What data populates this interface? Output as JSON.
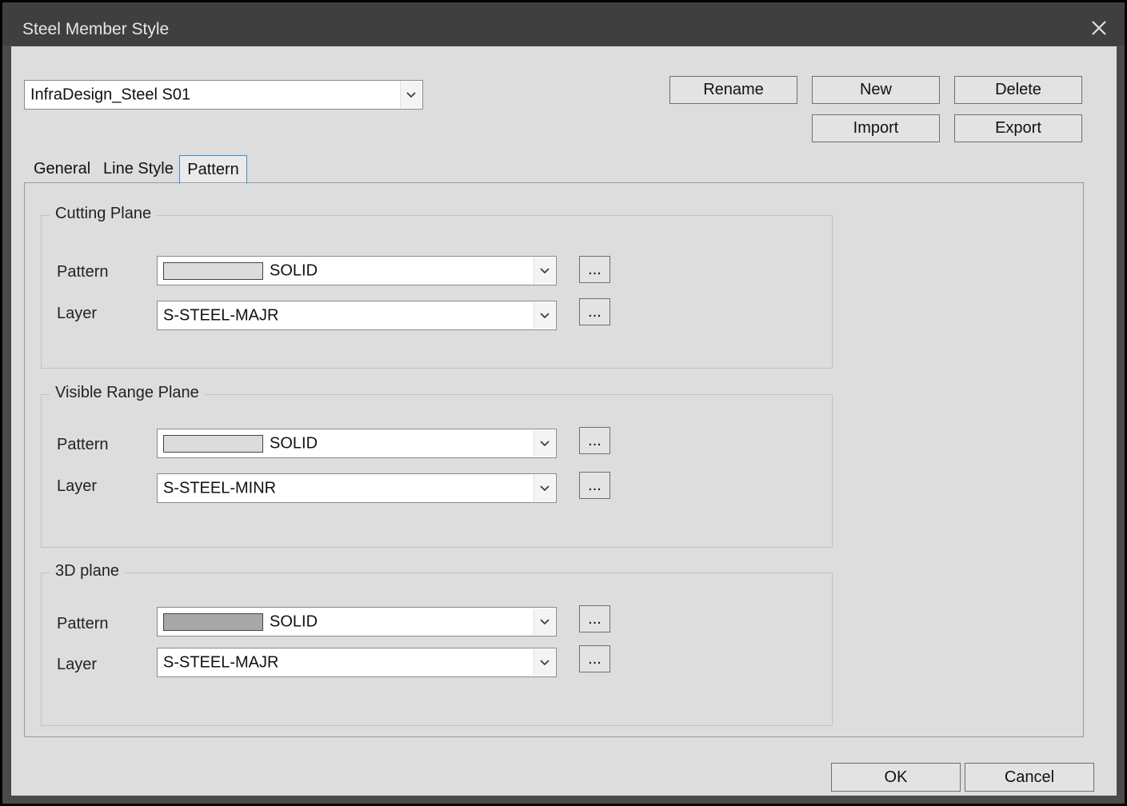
{
  "window": {
    "title": "Steel Member Style"
  },
  "style_selector": {
    "value": "InfraDesign_Steel S01"
  },
  "buttons": {
    "rename": "Rename",
    "new": "New",
    "delete": "Delete",
    "import": "Import",
    "export": "Export",
    "ok": "OK",
    "cancel": "Cancel"
  },
  "tabs": [
    {
      "label": "General",
      "active": false
    },
    {
      "label": "Line Style",
      "active": false
    },
    {
      "label": "Pattern",
      "active": true
    }
  ],
  "groups": {
    "cutting_plane": {
      "title": "Cutting Plane",
      "pattern_label": "Pattern",
      "pattern_value": "SOLID",
      "pattern_swatch_color": "#dcdcdc",
      "layer_label": "Layer",
      "layer_value": "S-STEEL-MAJR",
      "browse_label": "..."
    },
    "visible_range_plane": {
      "title": "Visible Range Plane",
      "pattern_label": "Pattern",
      "pattern_value": "SOLID",
      "pattern_swatch_color": "#dcdcdc",
      "layer_label": "Layer",
      "layer_value": "S-STEEL-MINR",
      "browse_label": "..."
    },
    "plane_3d": {
      "title": "3D plane",
      "pattern_label": "Pattern",
      "pattern_value": "SOLID",
      "pattern_swatch_color": "#a8a8a8",
      "layer_label": "Layer",
      "layer_value": "S-STEEL-MAJR",
      "browse_label": "..."
    }
  }
}
